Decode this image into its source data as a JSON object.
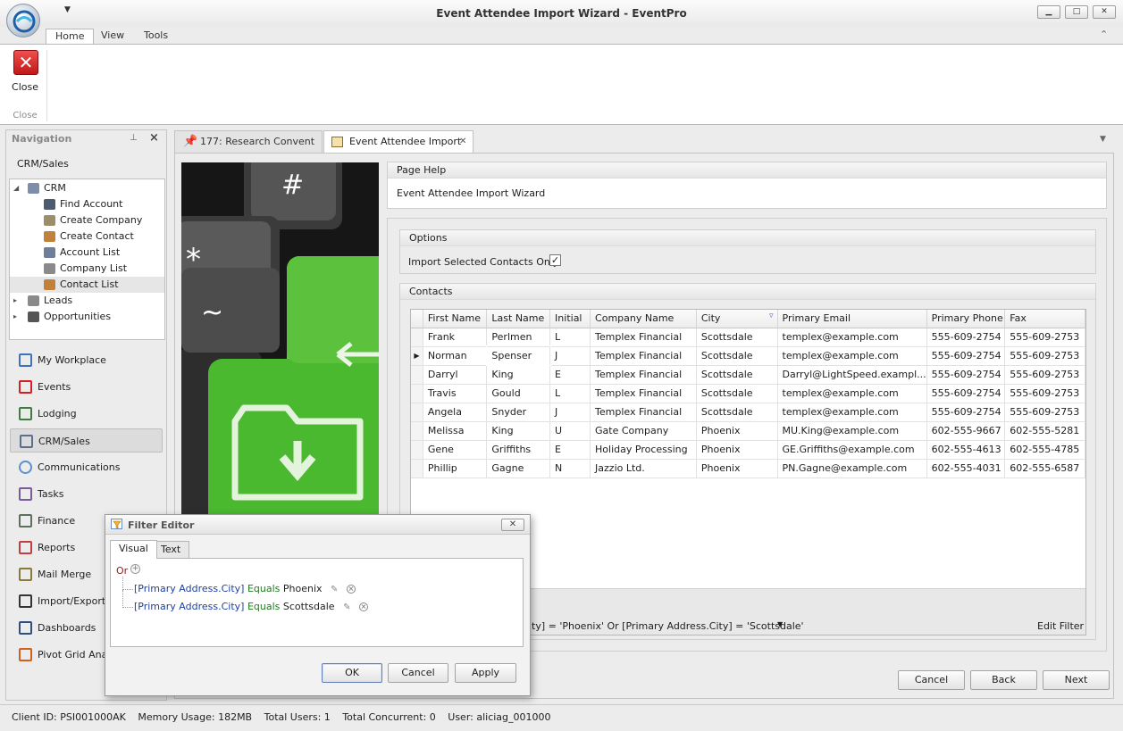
{
  "window": {
    "title": "Event Attendee Import Wizard - EventPro",
    "minimize": "▁",
    "maximize": "□",
    "close": "✕"
  },
  "ribbon": {
    "tabs": [
      "Home",
      "View",
      "Tools"
    ],
    "close_button": "Close",
    "group_label": "Close"
  },
  "navigation": {
    "header": "Navigation",
    "section_title": "CRM/Sales",
    "tree": [
      {
        "label": "CRM",
        "icon": "crm-icon",
        "level": 0,
        "expanded": true
      },
      {
        "label": "Find Account",
        "icon": "binoculars-icon",
        "level": 1
      },
      {
        "label": "Create Company",
        "icon": "create-company-icon",
        "level": 1
      },
      {
        "label": "Create Contact",
        "icon": "create-contact-icon",
        "level": 1
      },
      {
        "label": "Account List",
        "icon": "account-list-icon",
        "level": 1
      },
      {
        "label": "Company List",
        "icon": "company-list-icon",
        "level": 1
      },
      {
        "label": "Contact List",
        "icon": "contact-list-icon",
        "level": 1,
        "selected": true
      },
      {
        "label": "Leads",
        "icon": "leads-icon",
        "level": 0
      },
      {
        "label": "Opportunities",
        "icon": "opportunities-icon",
        "level": 0
      }
    ],
    "buttons": [
      {
        "label": "My Workplace",
        "icon": "workplace-icon"
      },
      {
        "label": "Events",
        "icon": "pin-icon"
      },
      {
        "label": "Lodging",
        "icon": "lodging-icon"
      },
      {
        "label": "CRM/Sales",
        "icon": "crm-sales-icon",
        "active": true
      },
      {
        "label": "Communications",
        "icon": "speech-bubble-icon"
      },
      {
        "label": "Tasks",
        "icon": "tasks-icon"
      },
      {
        "label": "Finance",
        "icon": "finance-icon"
      },
      {
        "label": "Reports",
        "icon": "reports-icon"
      },
      {
        "label": "Mail Merge",
        "icon": "mail-merge-icon"
      },
      {
        "label": "Import/Export",
        "icon": "import-export-icon"
      },
      {
        "label": "Dashboards",
        "icon": "dashboard-icon"
      },
      {
        "label": "Pivot Grid Analy",
        "icon": "pivot-grid-icon"
      }
    ]
  },
  "document_tabs": [
    {
      "label": "177: Research Convent",
      "icon": "pin-icon"
    },
    {
      "label": "Event Attendee Import",
      "icon": "import-icon",
      "active": true,
      "close": "✕"
    }
  ],
  "page_help": {
    "header": "Page Help",
    "text": "Event Attendee Import Wizard"
  },
  "options": {
    "header": "Options",
    "import_selected_label": "Import Selected Contacts Only:",
    "import_selected_checked": true
  },
  "contacts": {
    "header": "Contacts",
    "columns": [
      "First Name",
      "Last Name",
      "Initial",
      "Company Name",
      "City",
      "Primary Email",
      "Primary Phone",
      "Fax"
    ],
    "rows": [
      [
        "Frank",
        "Perlmen",
        "L",
        "Templex Financial",
        "Scottsdale",
        "templex@example.com",
        "555-609-2754",
        "555-609-2753"
      ],
      [
        "Norman",
        "Spenser",
        "J",
        "Templex Financial",
        "Scottsdale",
        "templex@example.com",
        "555-609-2754",
        "555-609-2753"
      ],
      [
        "Darryl",
        "King",
        "E",
        "Templex Financial",
        "Scottsdale",
        "Darryl@LightSpeed.exampl...",
        "555-609-2754",
        "555-609-2753"
      ],
      [
        "Travis",
        "Gould",
        "L",
        "Templex Financial",
        "Scottsdale",
        "templex@example.com",
        "555-609-2754",
        "555-609-2753"
      ],
      [
        "Angela",
        "Snyder",
        "J",
        "Templex Financial",
        "Scottsdale",
        "templex@example.com",
        "555-609-2754",
        "555-609-2753"
      ],
      [
        "Melissa",
        "King",
        "U",
        "Gate Company",
        "Phoenix",
        "MU.King@example.com",
        "602-555-9667",
        "602-555-5281"
      ],
      [
        "Gene",
        "Griffiths",
        "E",
        "Holiday Processing",
        "Phoenix",
        "GE.Griffiths@example.com",
        "602-555-4613",
        "602-555-4785"
      ],
      [
        "Phillip",
        "Gagne",
        "N",
        "Jazzio Ltd.",
        "Phoenix",
        "PN.Gagne@example.com",
        "602-555-4031",
        "602-555-6587"
      ]
    ],
    "focused_row": 1,
    "filter_expression": "ty] = 'Phoenix' Or [Primary Address.City] = 'Scottsdale'",
    "edit_filter": "Edit Filter"
  },
  "wizard_buttons": {
    "cancel": "Cancel",
    "back": "Back",
    "next": "Next"
  },
  "statusbar": {
    "client_id": "Client ID: PSI001000AK",
    "memory": "Memory Usage: 182MB",
    "total_users": "Total Users: 1",
    "total_concurrent": "Total Concurrent: 0",
    "user": "User: aliciag_001000"
  },
  "filter_editor": {
    "title": "Filter Editor",
    "tabs": [
      "Visual",
      "Text"
    ],
    "group_operator": "Or",
    "conditions": [
      {
        "field": "[Primary Address.City]",
        "operator": "Equals",
        "value": "Phoenix"
      },
      {
        "field": "[Primary Address.City]",
        "operator": "Equals",
        "value": "Scottsdale"
      }
    ],
    "ok": "OK",
    "cancel": "Cancel",
    "apply": "Apply"
  }
}
